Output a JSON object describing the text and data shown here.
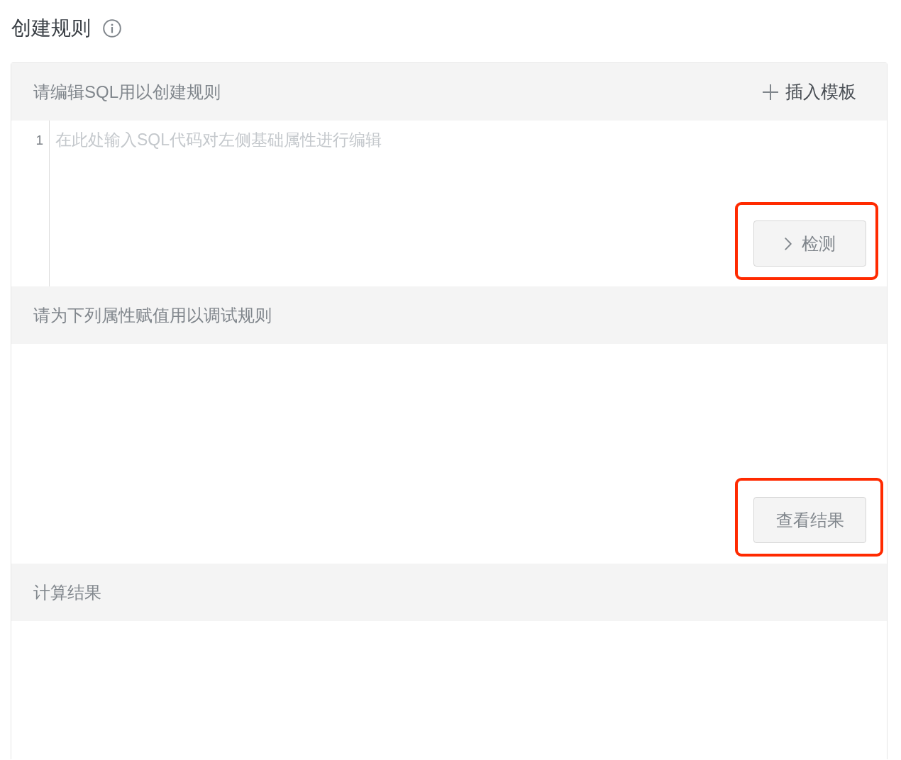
{
  "page": {
    "title": "创建规则"
  },
  "sections": [
    {
      "kind": "editor",
      "title": "请编辑SQL用以创建规则",
      "action": {
        "label": "插入模板"
      },
      "editor": {
        "line_numbers": [
          "1"
        ],
        "placeholder": "在此处输入SQL代码对左侧基础属性进行编辑"
      },
      "button": {
        "label": "检测",
        "highlighted": true
      }
    },
    {
      "kind": "form",
      "title": "请为下列属性赋值用以调试规则",
      "button": {
        "label": "查看结果",
        "highlighted": true
      }
    },
    {
      "kind": "result",
      "title": "计算结果"
    }
  ]
}
